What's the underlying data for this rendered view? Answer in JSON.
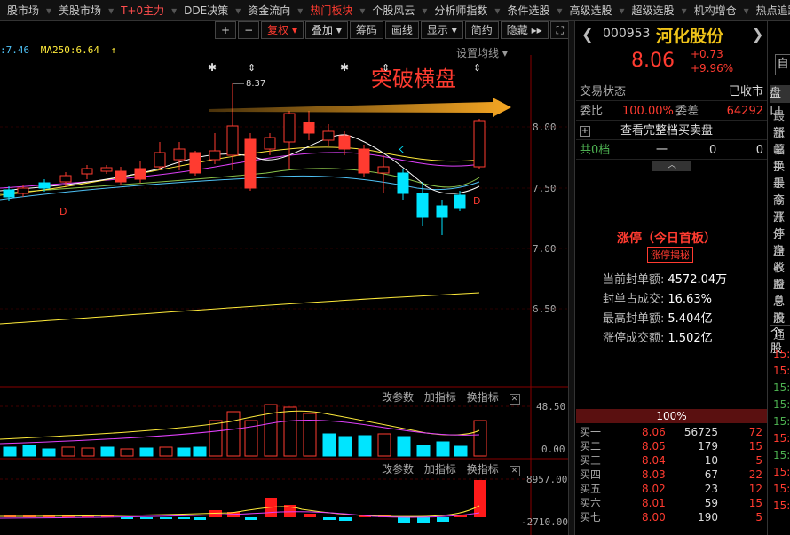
{
  "nav": [
    {
      "label": "股市场",
      "style": ""
    },
    {
      "label": "美股市场",
      "style": ""
    },
    {
      "label": "T+0主力",
      "style": "red"
    },
    {
      "label": "DDE决策",
      "style": ""
    },
    {
      "label": "资金流向",
      "style": ""
    },
    {
      "label": "热门板块",
      "style": "hot"
    },
    {
      "label": "个股风云",
      "style": ""
    },
    {
      "label": "分析师指数",
      "style": ""
    },
    {
      "label": "条件选股",
      "style": ""
    },
    {
      "label": "高级选股",
      "style": ""
    },
    {
      "label": "超级选股",
      "style": ""
    },
    {
      "label": "机构增仓",
      "style": ""
    },
    {
      "label": "热点追踪",
      "style": ""
    }
  ],
  "toolbar": {
    "plus": "+",
    "minus": "−",
    "fuquan": "复权",
    "diejia": "叠加",
    "chouma": "筹码",
    "huaxian": "画线",
    "xianshi": "显示",
    "jianyue": "简约",
    "yincang": "隐藏",
    "expand": "⛶"
  },
  "ma_line": {
    "ma_prefix": ":7.46",
    "ma250": "MA250:6.64"
  },
  "settings_label": "设置均线",
  "annotation": {
    "breakout": "突破横盘",
    "high_label": "8.37"
  },
  "price_axis": [
    "8.00",
    "7.50",
    "7.00",
    "6.50"
  ],
  "vol_panel": {
    "buttons": [
      "改参数",
      "加指标",
      "换指标"
    ],
    "max": "48.50",
    "zero": "0.00"
  },
  "macd_panel": {
    "buttons": [
      "改参数",
      "加指标",
      "换指标"
    ],
    "max": "8957.00",
    "min": "-2710.00"
  },
  "stock": {
    "code": "000953",
    "name": "河化股份",
    "price": "8.06",
    "change": "+0.73",
    "change_pct": "+9.96%"
  },
  "info": {
    "trade_status_label": "交易状态",
    "trade_status": "已收市",
    "weibi_label": "委比",
    "weibi": "100.00%",
    "weicha_label": "委差",
    "weicha": "64292",
    "full_book": "查看完整档买卖盘",
    "total_label": "共0档",
    "dash": "一",
    "zero1": "0",
    "zero2": "0"
  },
  "limit_up": {
    "title": "涨停（今日首板）",
    "badge": "涨停揭秘",
    "rows": [
      {
        "label": "当前封单额:",
        "value": "4572.04万"
      },
      {
        "label": "封单占成交:",
        "value": "16.63%"
      },
      {
        "label": "最高封单额:",
        "value": "5.404亿"
      },
      {
        "label": "涨停成交额:",
        "value": "1.502亿"
      }
    ]
  },
  "buy_pct": "100%",
  "bids": [
    {
      "name": "买一",
      "price": "8.06",
      "vol": "56725",
      "cnt": "72"
    },
    {
      "name": "买二",
      "price": "8.05",
      "vol": "179",
      "cnt": "15"
    },
    {
      "name": "买三",
      "price": "8.04",
      "vol": "10",
      "cnt": "5"
    },
    {
      "name": "买四",
      "price": "8.03",
      "vol": "67",
      "cnt": "22"
    },
    {
      "name": "买五",
      "price": "8.02",
      "vol": "23",
      "cnt": "12"
    },
    {
      "name": "买六",
      "price": "8.01",
      "vol": "59",
      "cnt": "15"
    },
    {
      "name": "买七",
      "price": "8.00",
      "vol": "190",
      "cnt": "5"
    }
  ],
  "far_panel": {
    "zi": "自",
    "tab": "盘口",
    "labels": [
      "最新",
      "涨幅",
      "总手",
      "换手",
      "最高",
      "今开",
      "涨停",
      "外盘",
      "净衫",
      "收益",
      "股息",
      "总股",
      "流通"
    ],
    "tab2": "个股",
    "times": [
      "15:",
      "15:",
      "15:",
      "15:",
      "15:",
      "15:",
      "15:",
      "15:",
      "15:",
      "15:"
    ]
  }
}
